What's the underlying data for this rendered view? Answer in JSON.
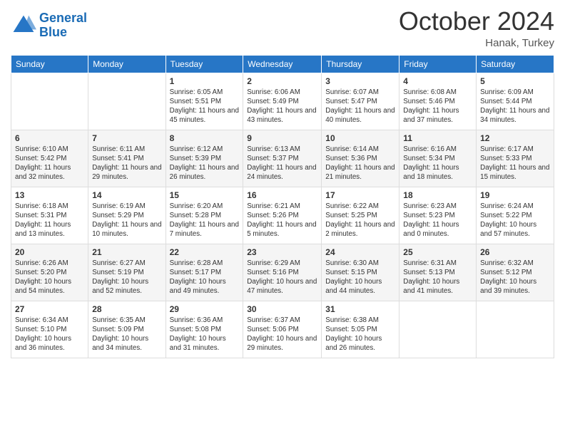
{
  "header": {
    "logo_line1": "General",
    "logo_line2": "Blue",
    "month": "October 2024",
    "location": "Hanak, Turkey"
  },
  "weekdays": [
    "Sunday",
    "Monday",
    "Tuesday",
    "Wednesday",
    "Thursday",
    "Friday",
    "Saturday"
  ],
  "weeks": [
    [
      {
        "day": "",
        "info": ""
      },
      {
        "day": "",
        "info": ""
      },
      {
        "day": "1",
        "info": "Sunrise: 6:05 AM\nSunset: 5:51 PM\nDaylight: 11 hours and 45 minutes."
      },
      {
        "day": "2",
        "info": "Sunrise: 6:06 AM\nSunset: 5:49 PM\nDaylight: 11 hours and 43 minutes."
      },
      {
        "day": "3",
        "info": "Sunrise: 6:07 AM\nSunset: 5:47 PM\nDaylight: 11 hours and 40 minutes."
      },
      {
        "day": "4",
        "info": "Sunrise: 6:08 AM\nSunset: 5:46 PM\nDaylight: 11 hours and 37 minutes."
      },
      {
        "day": "5",
        "info": "Sunrise: 6:09 AM\nSunset: 5:44 PM\nDaylight: 11 hours and 34 minutes."
      }
    ],
    [
      {
        "day": "6",
        "info": "Sunrise: 6:10 AM\nSunset: 5:42 PM\nDaylight: 11 hours and 32 minutes."
      },
      {
        "day": "7",
        "info": "Sunrise: 6:11 AM\nSunset: 5:41 PM\nDaylight: 11 hours and 29 minutes."
      },
      {
        "day": "8",
        "info": "Sunrise: 6:12 AM\nSunset: 5:39 PM\nDaylight: 11 hours and 26 minutes."
      },
      {
        "day": "9",
        "info": "Sunrise: 6:13 AM\nSunset: 5:37 PM\nDaylight: 11 hours and 24 minutes."
      },
      {
        "day": "10",
        "info": "Sunrise: 6:14 AM\nSunset: 5:36 PM\nDaylight: 11 hours and 21 minutes."
      },
      {
        "day": "11",
        "info": "Sunrise: 6:16 AM\nSunset: 5:34 PM\nDaylight: 11 hours and 18 minutes."
      },
      {
        "day": "12",
        "info": "Sunrise: 6:17 AM\nSunset: 5:33 PM\nDaylight: 11 hours and 15 minutes."
      }
    ],
    [
      {
        "day": "13",
        "info": "Sunrise: 6:18 AM\nSunset: 5:31 PM\nDaylight: 11 hours and 13 minutes."
      },
      {
        "day": "14",
        "info": "Sunrise: 6:19 AM\nSunset: 5:29 PM\nDaylight: 11 hours and 10 minutes."
      },
      {
        "day": "15",
        "info": "Sunrise: 6:20 AM\nSunset: 5:28 PM\nDaylight: 11 hours and 7 minutes."
      },
      {
        "day": "16",
        "info": "Sunrise: 6:21 AM\nSunset: 5:26 PM\nDaylight: 11 hours and 5 minutes."
      },
      {
        "day": "17",
        "info": "Sunrise: 6:22 AM\nSunset: 5:25 PM\nDaylight: 11 hours and 2 minutes."
      },
      {
        "day": "18",
        "info": "Sunrise: 6:23 AM\nSunset: 5:23 PM\nDaylight: 11 hours and 0 minutes."
      },
      {
        "day": "19",
        "info": "Sunrise: 6:24 AM\nSunset: 5:22 PM\nDaylight: 10 hours and 57 minutes."
      }
    ],
    [
      {
        "day": "20",
        "info": "Sunrise: 6:26 AM\nSunset: 5:20 PM\nDaylight: 10 hours and 54 minutes."
      },
      {
        "day": "21",
        "info": "Sunrise: 6:27 AM\nSunset: 5:19 PM\nDaylight: 10 hours and 52 minutes."
      },
      {
        "day": "22",
        "info": "Sunrise: 6:28 AM\nSunset: 5:17 PM\nDaylight: 10 hours and 49 minutes."
      },
      {
        "day": "23",
        "info": "Sunrise: 6:29 AM\nSunset: 5:16 PM\nDaylight: 10 hours and 47 minutes."
      },
      {
        "day": "24",
        "info": "Sunrise: 6:30 AM\nSunset: 5:15 PM\nDaylight: 10 hours and 44 minutes."
      },
      {
        "day": "25",
        "info": "Sunrise: 6:31 AM\nSunset: 5:13 PM\nDaylight: 10 hours and 41 minutes."
      },
      {
        "day": "26",
        "info": "Sunrise: 6:32 AM\nSunset: 5:12 PM\nDaylight: 10 hours and 39 minutes."
      }
    ],
    [
      {
        "day": "27",
        "info": "Sunrise: 6:34 AM\nSunset: 5:10 PM\nDaylight: 10 hours and 36 minutes."
      },
      {
        "day": "28",
        "info": "Sunrise: 6:35 AM\nSunset: 5:09 PM\nDaylight: 10 hours and 34 minutes."
      },
      {
        "day": "29",
        "info": "Sunrise: 6:36 AM\nSunset: 5:08 PM\nDaylight: 10 hours and 31 minutes."
      },
      {
        "day": "30",
        "info": "Sunrise: 6:37 AM\nSunset: 5:06 PM\nDaylight: 10 hours and 29 minutes."
      },
      {
        "day": "31",
        "info": "Sunrise: 6:38 AM\nSunset: 5:05 PM\nDaylight: 10 hours and 26 minutes."
      },
      {
        "day": "",
        "info": ""
      },
      {
        "day": "",
        "info": ""
      }
    ]
  ]
}
